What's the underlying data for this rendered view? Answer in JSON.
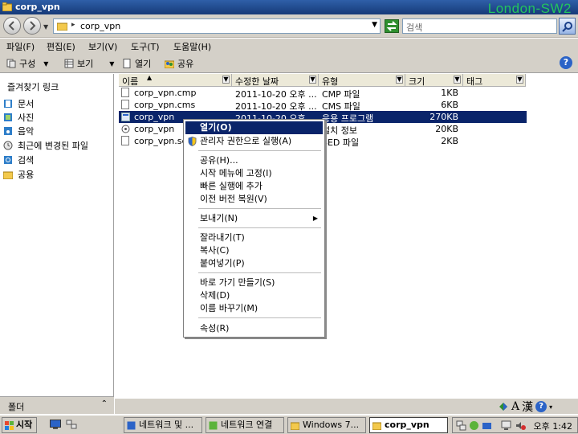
{
  "window": {
    "title": "corp_vpn",
    "watermark": "London-SW2"
  },
  "address": {
    "path": "corp_vpn",
    "search_placeholder": "검색"
  },
  "menu": [
    "파일(F)",
    "편집(E)",
    "보기(V)",
    "도구(T)",
    "도움말(H)"
  ],
  "toolbar": {
    "organize": "구성",
    "view": "보기",
    "open": "열기",
    "share": "공유"
  },
  "favorites": {
    "header": "즐겨찾기 링크",
    "items": [
      "문서",
      "사진",
      "음악",
      "최근에 변경된 파일",
      "검색",
      "공용"
    ]
  },
  "folder_bar": "폴더",
  "columns": [
    "이름",
    "수정한 날짜",
    "유형",
    "크기",
    "태그"
  ],
  "files": [
    {
      "name": "corp_vpn.cmp",
      "date": "2011-10-20 오후 ...",
      "type": "CMP 파일",
      "size": "1KB"
    },
    {
      "name": "corp_vpn.cms",
      "date": "2011-10-20 오후 ...",
      "type": "CMS 파일",
      "size": "6KB"
    },
    {
      "name": "corp_vpn",
      "date": "2011-10-20 오후 ...",
      "type": "응용 프로그램",
      "size": "270KB"
    },
    {
      "name": "corp_vpn",
      "date": "",
      "type": "설치 정보",
      "size": "20KB"
    },
    {
      "name": "corp_vpn.sed",
      "date": "",
      "type": "SED 파일",
      "size": "2KB"
    }
  ],
  "context_menu": {
    "open": "열기(O)",
    "run_as_admin": "관리자 권한으로 실행(A)",
    "share": "공유(H)...",
    "pin_start": "시작 메뉴에 고정(I)",
    "add_quick": "빠른 실행에 추가",
    "restore": "이전 버전 복원(V)",
    "send_to": "보내기(N)",
    "cut": "잘라내기(T)",
    "copy": "복사(C)",
    "paste": "붙여넣기(P)",
    "shortcut": "바로 가기 만들기(S)",
    "delete": "삭제(D)",
    "rename": "이름 바꾸기(M)",
    "properties": "속성(R)"
  },
  "ime": {
    "mode": "A",
    "hanja": "漢"
  },
  "taskbar": {
    "start": "시작",
    "tasks": [
      "네트워크 및 ...",
      "네트워크 연결",
      "Windows 7...",
      "corp_vpn"
    ],
    "clock": "오후 1:42"
  }
}
